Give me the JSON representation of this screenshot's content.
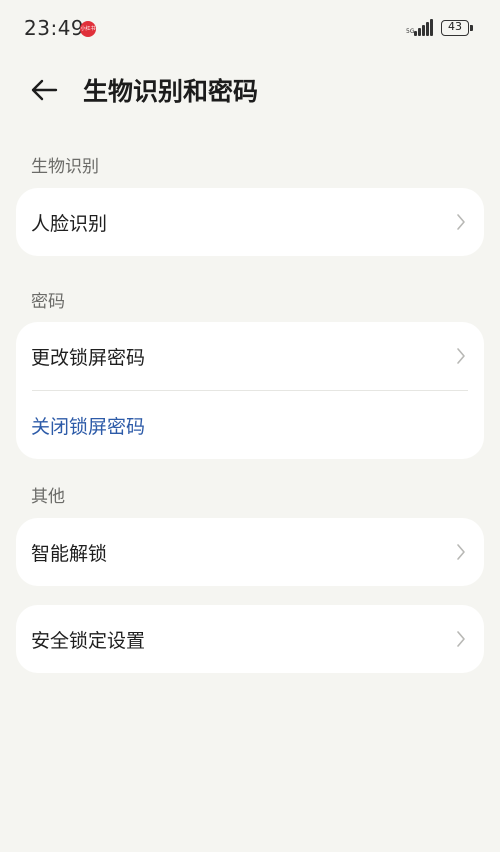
{
  "status_bar": {
    "time": "23:49",
    "app_badge": "小红书",
    "network_label": "5G",
    "battery": "43"
  },
  "header": {
    "title": "生物识别和密码"
  },
  "sections": {
    "biometrics": {
      "label": "生物识别",
      "items": [
        {
          "label": "人脸识别"
        }
      ]
    },
    "password": {
      "label": "密码",
      "items": [
        {
          "label": "更改锁屏密码"
        },
        {
          "label": "关闭锁屏密码"
        }
      ]
    },
    "other": {
      "label": "其他",
      "items": [
        {
          "label": "智能解锁"
        }
      ]
    },
    "security": {
      "items": [
        {
          "label": "安全锁定设置"
        }
      ]
    }
  },
  "colors": {
    "background": "#f5f5f1",
    "card": "#ffffff",
    "link_blue": "#2d5ba8",
    "section_label": "#6b6b68"
  },
  "icons": [
    "back-arrow-icon",
    "chevron-right-icon",
    "signal-icon",
    "battery-icon"
  ]
}
